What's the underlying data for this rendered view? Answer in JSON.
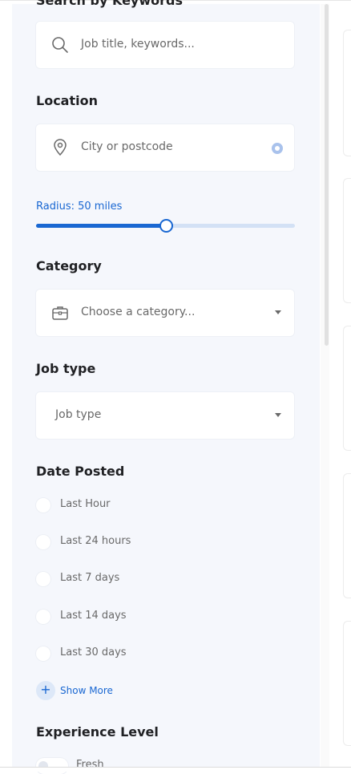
{
  "search": {
    "section_title": "Search by Keywords",
    "placeholder": "Job title, keywords..."
  },
  "location": {
    "label": "Location",
    "placeholder": "City or postcode"
  },
  "radius": {
    "label": "Radius: 50 miles",
    "value_fraction": 0.5
  },
  "category": {
    "label": "Category",
    "placeholder": "Choose a category..."
  },
  "job_type": {
    "label": "Job type",
    "selected": "Job type"
  },
  "date_posted": {
    "label": "Date Posted",
    "options": [
      "Last Hour",
      "Last 24 hours",
      "Last 7 days",
      "Last 14 days",
      "Last 30 days"
    ],
    "show_more": "Show More"
  },
  "experience": {
    "label": "Experience Level",
    "first_option": "Fresh"
  },
  "colors": {
    "accent": "#1967d2",
    "sidebar_bg": "#f5f7fc",
    "muted_text": "#696969"
  },
  "icons": [
    "search-icon",
    "map-pin-icon",
    "locate-icon",
    "briefcase-icon",
    "chevron-down-icon",
    "plus-icon"
  ]
}
